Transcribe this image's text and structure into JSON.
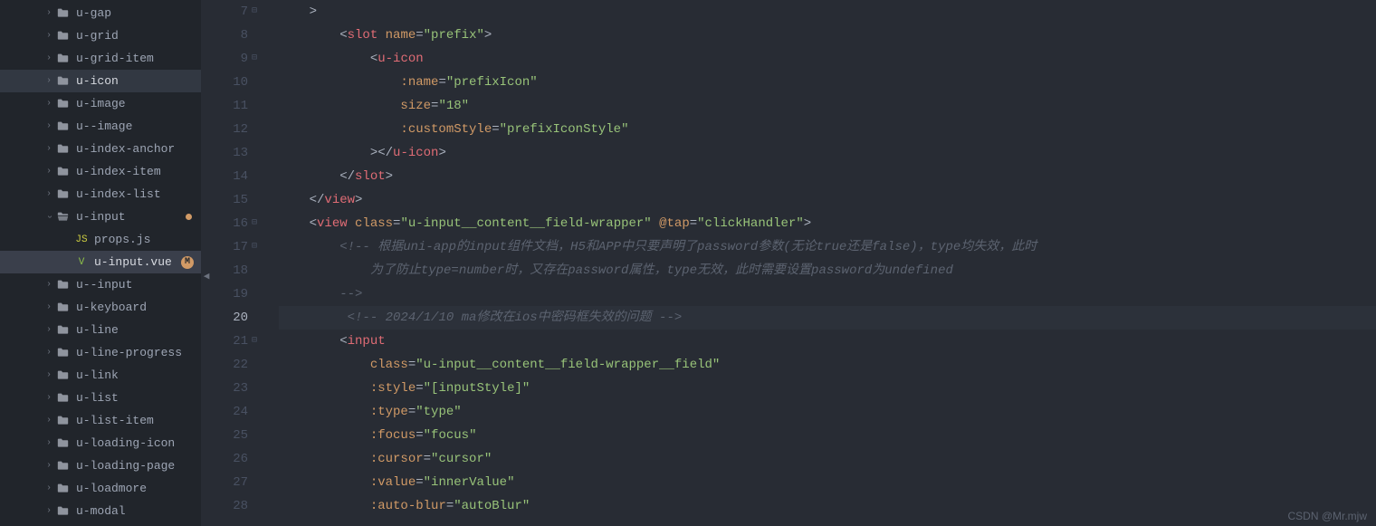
{
  "sidebar": {
    "items": [
      {
        "name": "u-gap",
        "type": "folder",
        "indent": 50
      },
      {
        "name": "u-grid",
        "type": "folder",
        "indent": 50
      },
      {
        "name": "u-grid-item",
        "type": "folder",
        "indent": 50
      },
      {
        "name": "u-icon",
        "type": "folder",
        "indent": 50,
        "active": true,
        "openIcon": true
      },
      {
        "name": "u-image",
        "type": "folder",
        "indent": 50
      },
      {
        "name": "u--image",
        "type": "folder",
        "indent": 50
      },
      {
        "name": "u-index-anchor",
        "type": "folder",
        "indent": 50
      },
      {
        "name": "u-index-item",
        "type": "folder",
        "indent": 50
      },
      {
        "name": "u-index-list",
        "type": "folder",
        "indent": 50
      },
      {
        "name": "u-input",
        "type": "folder",
        "indent": 50,
        "expanded": true,
        "modified": true
      },
      {
        "name": "props.js",
        "type": "file-js",
        "indent": 70
      },
      {
        "name": "u-input.vue",
        "type": "file-vue",
        "indent": 70,
        "selected": true,
        "mbadge": true
      },
      {
        "name": "u--input",
        "type": "folder",
        "indent": 50
      },
      {
        "name": "u-keyboard",
        "type": "folder",
        "indent": 50
      },
      {
        "name": "u-line",
        "type": "folder",
        "indent": 50
      },
      {
        "name": "u-line-progress",
        "type": "folder",
        "indent": 50
      },
      {
        "name": "u-link",
        "type": "folder",
        "indent": 50
      },
      {
        "name": "u-list",
        "type": "folder",
        "indent": 50
      },
      {
        "name": "u-list-item",
        "type": "folder",
        "indent": 50
      },
      {
        "name": "u-loading-icon",
        "type": "folder",
        "indent": 50
      },
      {
        "name": "u-loading-page",
        "type": "folder",
        "indent": 50
      },
      {
        "name": "u-loadmore",
        "type": "folder",
        "indent": 50
      },
      {
        "name": "u-modal",
        "type": "folder",
        "indent": 50
      }
    ]
  },
  "gutter": {
    "lines": [
      {
        "num": "7",
        "fold": true
      },
      {
        "num": "8"
      },
      {
        "num": "9",
        "fold": true
      },
      {
        "num": "10"
      },
      {
        "num": "11"
      },
      {
        "num": "12"
      },
      {
        "num": "13"
      },
      {
        "num": "14"
      },
      {
        "num": "15"
      },
      {
        "num": "16",
        "fold": true
      },
      {
        "num": "17",
        "fold": true
      },
      {
        "num": "18"
      },
      {
        "num": "19"
      },
      {
        "num": "20",
        "current": true
      },
      {
        "num": "21",
        "fold": true
      },
      {
        "num": "22"
      },
      {
        "num": "23"
      },
      {
        "num": "24"
      },
      {
        "num": "25"
      },
      {
        "num": "26"
      },
      {
        "num": "27"
      },
      {
        "num": "28"
      }
    ]
  },
  "code": {
    "l7": ">",
    "l8": {
      "tag": "slot",
      "attr": "name",
      "val": "prefix"
    },
    "l9": {
      "tag": "u-icon"
    },
    "l10": {
      "attr": ":name",
      "val": "prefixIcon"
    },
    "l11": {
      "attr": "size",
      "val": "18"
    },
    "l12": {
      "attr": ":customStyle",
      "val": "prefixIconStyle"
    },
    "l13": {
      "tag": "u-icon"
    },
    "l14": {
      "tag": "slot"
    },
    "l15": {
      "tag": "view"
    },
    "l16": {
      "tag": "view",
      "attr1": "class",
      "val1": "u-input__content__field-wrapper",
      "attr2": "@tap",
      "val2": "clickHandler"
    },
    "l17": "<!-- 根据uni-app的input组件文档，H5和APP中只要声明了password参数(无论true还是false)，type均失效，此时",
    "l18": "为了防止type=number时，又存在password属性，type无效，此时需要设置password为undefined",
    "l19": "-->",
    "l20": "<!-- 2024/1/10 ma修改在ios中密码框失效的问题 -->",
    "l21": {
      "tag": "input"
    },
    "l22": {
      "attr": "class",
      "val": "u-input__content__field-wrapper__field"
    },
    "l23": {
      "attr": ":style",
      "val": "[inputStyle]"
    },
    "l24": {
      "attr": ":type",
      "val": "type"
    },
    "l25": {
      "attr": ":focus",
      "val": "focus"
    },
    "l26": {
      "attr": ":cursor",
      "val": "cursor"
    },
    "l27": {
      "attr": ":value",
      "val": "innerValue"
    },
    "l28": {
      "attr": ":auto-blur",
      "val": "autoBlur"
    }
  },
  "watermark": "CSDN @Mr.mjw"
}
